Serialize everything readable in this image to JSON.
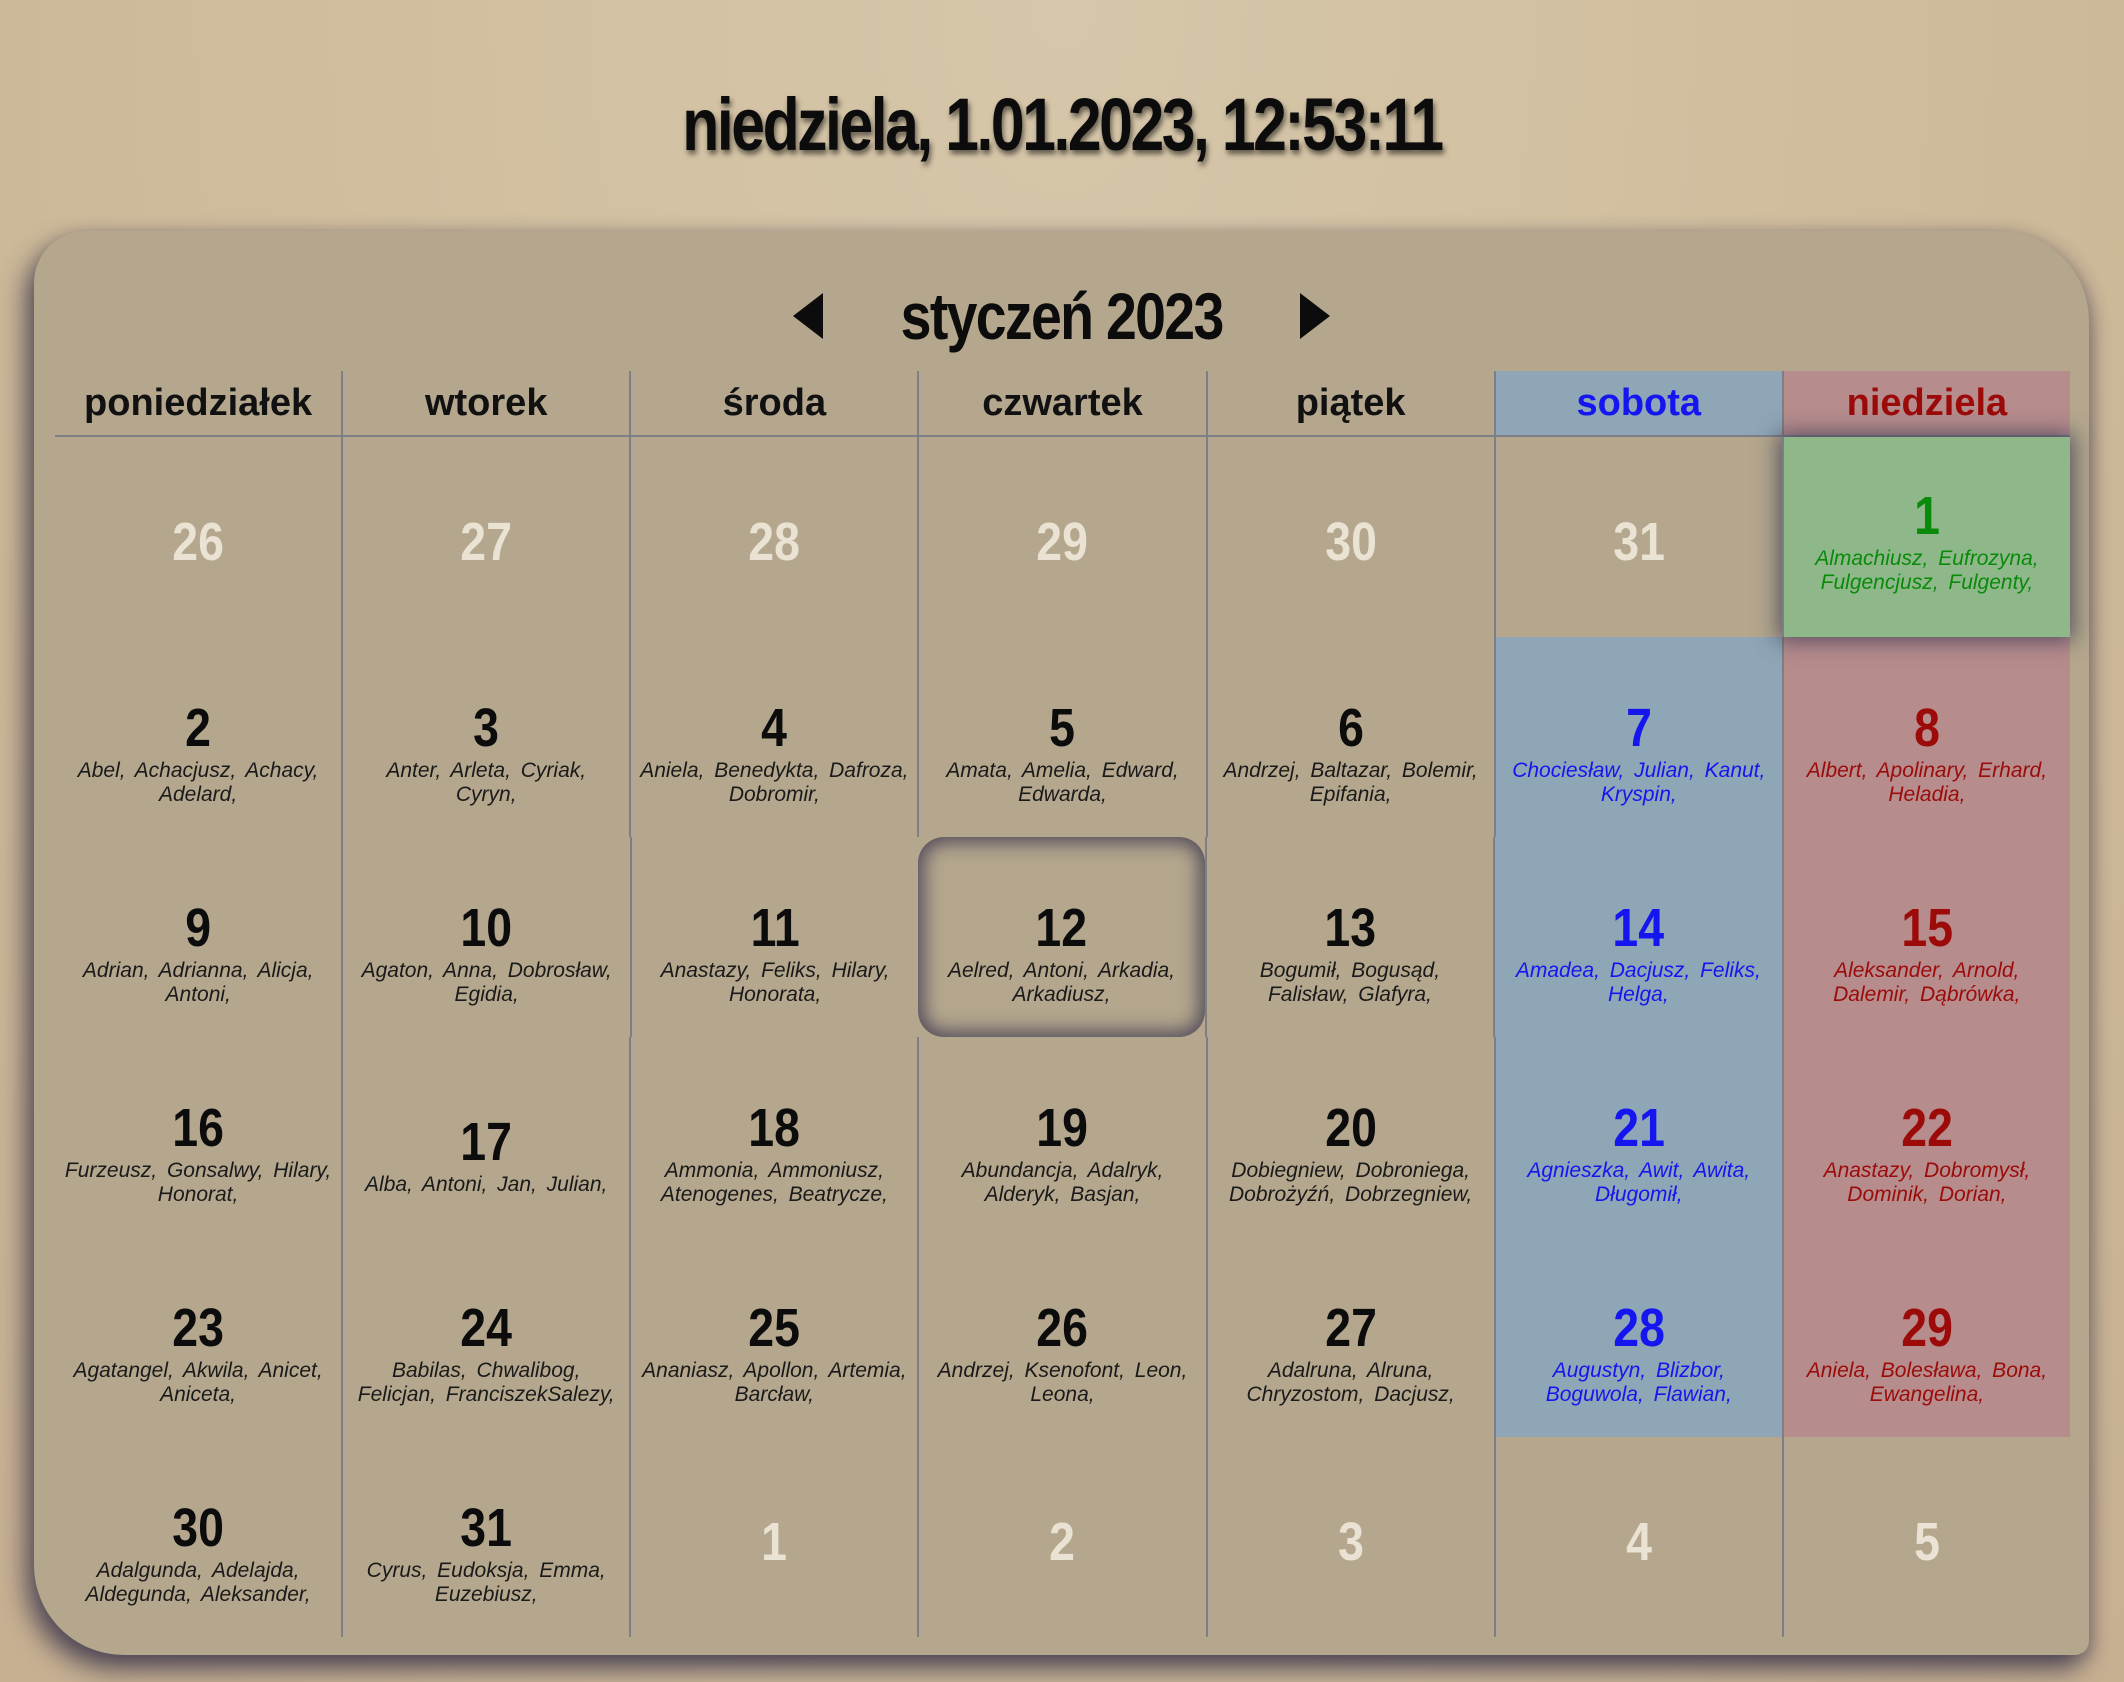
{
  "clock": "niedziela,  1.01.2023,  12:53:11",
  "calendar": {
    "title": "styczeń 2023",
    "weekdays": [
      "poniedziałek",
      "wtorek",
      "środa",
      "czwartek",
      "piątek",
      "sobota",
      "niedziela"
    ]
  },
  "weeks": [
    [
      {
        "day": "26",
        "names": ""
      },
      {
        "day": "27",
        "names": ""
      },
      {
        "day": "28",
        "names": ""
      },
      {
        "day": "29",
        "names": ""
      },
      {
        "day": "30",
        "names": ""
      },
      {
        "day": "31",
        "names": ""
      },
      {
        "day": "1",
        "names": "Almachiusz,  Eufrozyna,  Fulgencjusz,  Fulgenty,"
      }
    ],
    [
      {
        "day": "2",
        "names": "Abel,  Achacjusz,  Achacy,  Adelard,"
      },
      {
        "day": "3",
        "names": "Anter,  Arleta,  Cyriak,  Cyryn,"
      },
      {
        "day": "4",
        "names": "Aniela,  Benedykta,  Dafroza,  Dobromir,"
      },
      {
        "day": "5",
        "names": "Amata,  Amelia,  Edward,  Edwarda,"
      },
      {
        "day": "6",
        "names": "Andrzej,  Baltazar,  Bolemir,  Epifania,"
      },
      {
        "day": "7",
        "names": "Chociesław,  Julian,  Kanut,  Kryspin,"
      },
      {
        "day": "8",
        "names": "Albert,  Apolinary,  Erhard,  Heladia,"
      }
    ],
    [
      {
        "day": "9",
        "names": "Adrian,  Adrianna,  Alicja,  Antoni,"
      },
      {
        "day": "10",
        "names": "Agaton,  Anna,  Dobrosław,  Egidia,"
      },
      {
        "day": "11",
        "names": "Anastazy,  Feliks,  Hilary,  Honorata,"
      },
      {
        "day": "12",
        "names": "Aelred,  Antoni,  Arkadia,  Arkadiusz,"
      },
      {
        "day": "13",
        "names": "Bogumił,  Bogusąd,  Falisław,  Glafyra,"
      },
      {
        "day": "14",
        "names": "Amadea,  Dacjusz,  Feliks,  Helga,"
      },
      {
        "day": "15",
        "names": "Aleksander,  Arnold,  Dalemir,  Dąbrówka,"
      }
    ],
    [
      {
        "day": "16",
        "names": "Furzeusz,  Gonsalwy,  Hilary,  Honorat,"
      },
      {
        "day": "17",
        "names": "Alba,  Antoni,  Jan,  Julian,"
      },
      {
        "day": "18",
        "names": "Ammonia,  Ammoniusz,  Atenogenes,  Beatrycze,"
      },
      {
        "day": "19",
        "names": "Abundancja,  Adalryk,  Alderyk,  Basjan,"
      },
      {
        "day": "20",
        "names": "Dobiegniew,  Dobroniega,  Dobrożyźń,  Dobrzegniew,"
      },
      {
        "day": "21",
        "names": "Agnieszka,  Awit,  Awita,  Długomił,"
      },
      {
        "day": "22",
        "names": "Anastazy,  Dobromysł,  Dominik,  Dorian,"
      }
    ],
    [
      {
        "day": "23",
        "names": "Agatangel,  Akwila,  Anicet,  Aniceta,"
      },
      {
        "day": "24",
        "names": "Babilas,  Chwalibog,  Felicjan,  FranciszekSalezy,"
      },
      {
        "day": "25",
        "names": "Ananiasz,  Apollon,  Artemia,  Barcław,"
      },
      {
        "day": "26",
        "names": "Andrzej,  Ksenofont,  Leon,  Leona,"
      },
      {
        "day": "27",
        "names": "Adalruna,  Alruna,  Chryzostom,  Dacjusz,"
      },
      {
        "day": "28",
        "names": "Augustyn,  Blizbor,  Boguwola,  Flawian,"
      },
      {
        "day": "29",
        "names": "Aniela,  Bolesława,  Bona,  Ewangelina,"
      }
    ],
    [
      {
        "day": "30",
        "names": "Adalgunda,  Adelajda,  Aldegunda,  Aleksander,"
      },
      {
        "day": "31",
        "names": "Cyrus,  Eudoksja,  Emma,  Euzebiusz,"
      },
      {
        "day": "1",
        "names": ""
      },
      {
        "day": "2",
        "names": ""
      },
      {
        "day": "3",
        "names": ""
      },
      {
        "day": "4",
        "names": ""
      },
      {
        "day": "5",
        "names": ""
      }
    ]
  ],
  "colors": {
    "saturday": "#1515f0",
    "sunday": "#9c0a0a",
    "today": "#0a8a0a",
    "saturday_bg": "#8ea6b6",
    "sunday_bg": "#b68c8c",
    "today_bg": "#8fb88a"
  },
  "icons": {
    "prev": "triangle-left-icon",
    "next": "triangle-right-icon"
  }
}
